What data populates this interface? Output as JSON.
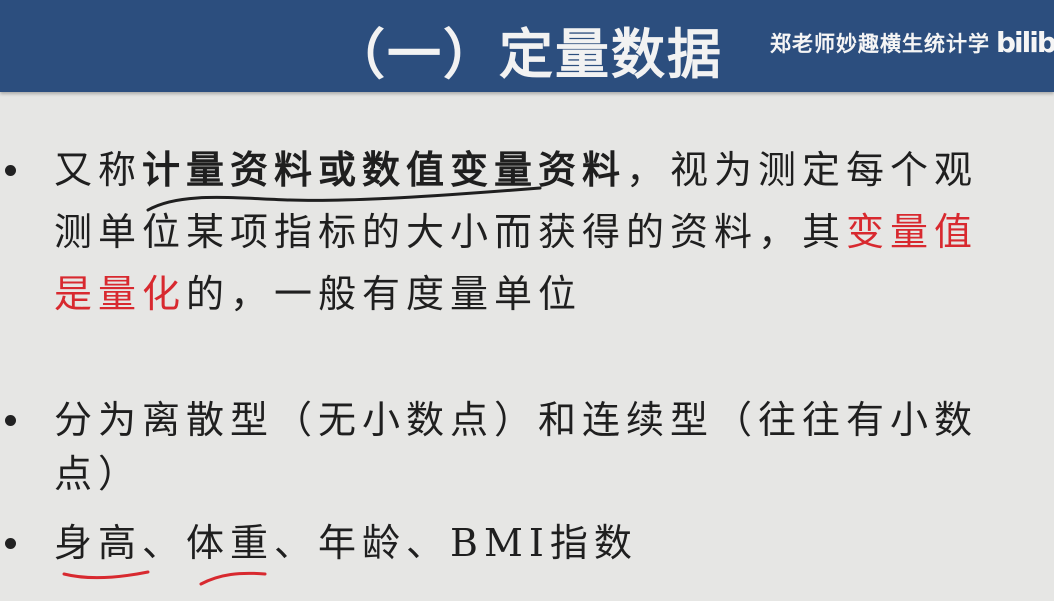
{
  "header": {
    "title": "（一）定量数据",
    "watermark": "郑老师妙趣横生统计学",
    "logo_icon": "bilibili-logo",
    "logo_text": "bilibili"
  },
  "bullets": [
    {
      "lines": [
        [
          "又称",
          "计量资料或数值变量资料",
          "，视为测定每个观"
        ],
        [
          "测单位某项指标的大小而获得的资料，其",
          "变量值"
        ],
        [
          "是量化",
          "的，一般有度量单位"
        ]
      ]
    },
    {
      "lines": [
        [
          "分为离散型（无小数点）和连续型（往往有小数"
        ],
        [
          "点）"
        ]
      ]
    },
    {
      "lines": [
        [
          "身高",
          "、",
          "体重",
          "、年龄、BMI指数"
        ]
      ]
    }
  ],
  "colors": {
    "header_bg": "#2c4e7e",
    "body_bg": "#e6e6e4",
    "highlight_red": "#d8292f",
    "text": "#1f1f1f"
  }
}
